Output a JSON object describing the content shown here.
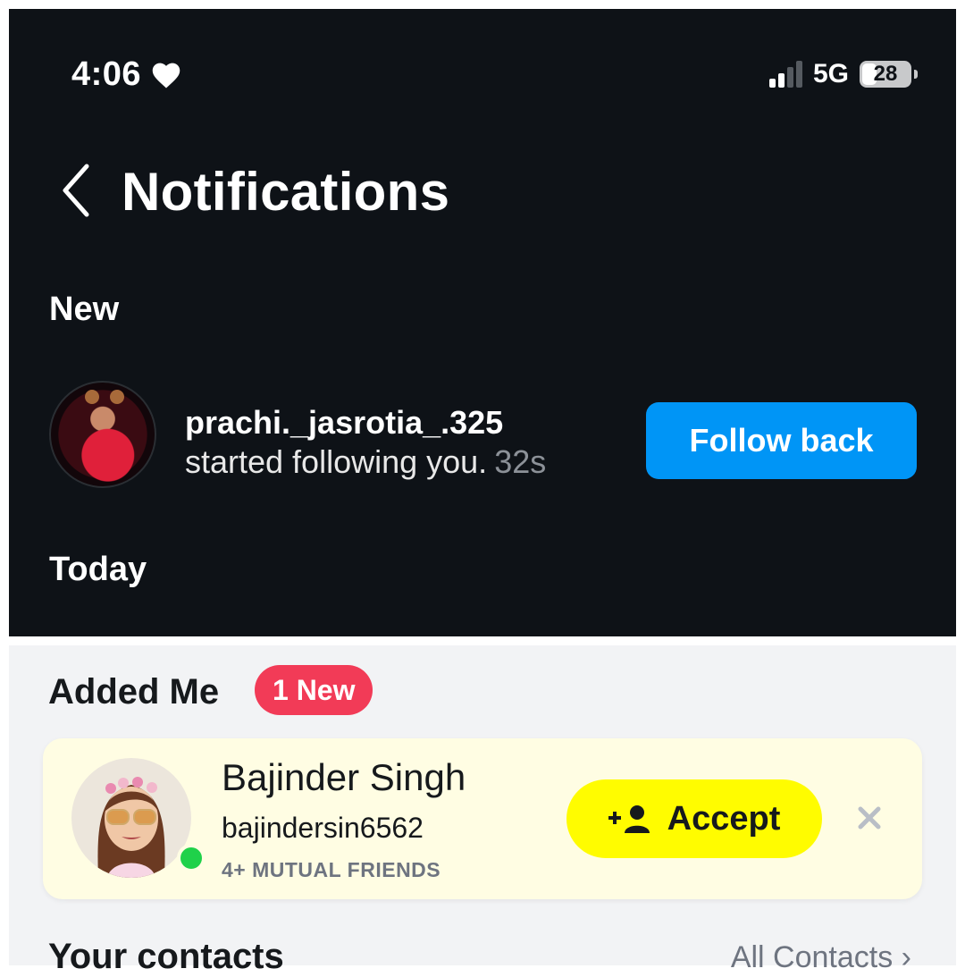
{
  "status_bar": {
    "time": "4:06",
    "network": "5G",
    "battery": "28",
    "icons": [
      "heart-icon",
      "signal-icon",
      "battery-icon"
    ]
  },
  "header": {
    "title": "Notifications",
    "back_icon": "chevron-left-icon"
  },
  "sections": {
    "new_label": "New",
    "today_label": "Today"
  },
  "notification": {
    "username": "prachi._jasrotia_.325",
    "message": "started following you.",
    "time": "32s",
    "button_label": "Follow back"
  },
  "added_me": {
    "title": "Added Me",
    "badge": "1 New",
    "request": {
      "name": "Bajinder Singh",
      "handle": "bajindersin6562",
      "mutual": "4+ MUTUAL FRIENDS",
      "accept_label": "Accept",
      "accept_icon": "add-friend-icon",
      "dismiss_icon": "close-icon"
    }
  },
  "contacts": {
    "title": "Your contacts",
    "link": "All Contacts ›"
  },
  "colors": {
    "dark_bg": "#0e1217",
    "follow_blue": "#0095f6",
    "badge_red": "#f23b57",
    "accept_yellow": "#fffc00",
    "online_green": "#1fd14a",
    "card_bg": "#fffde3"
  }
}
